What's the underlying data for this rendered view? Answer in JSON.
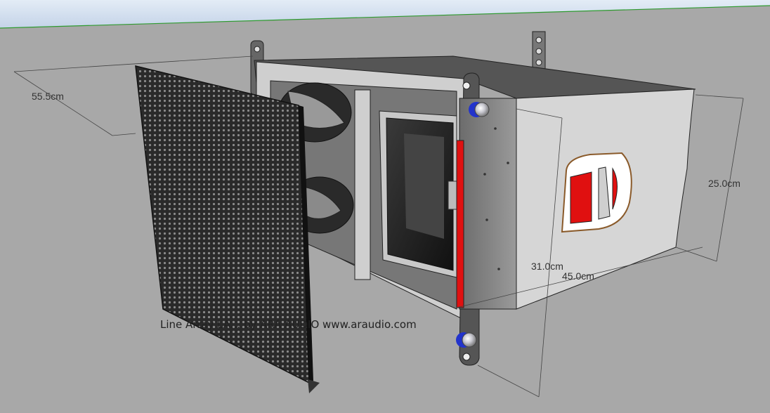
{
  "caption": "Line Array LA... by ARA AUDIO www.araudio.com",
  "dimensions": {
    "depth": "55.5cm",
    "height": "25.0cm",
    "vertical_span": "31.0cm",
    "width": "45.0cm"
  },
  "colors": {
    "sky": "#c9d7ea",
    "ground": "#a9a9a9",
    "horizon_line": "#2f9a2f",
    "accent_red": "#e01010",
    "bolt_blue": "#2233cc"
  }
}
